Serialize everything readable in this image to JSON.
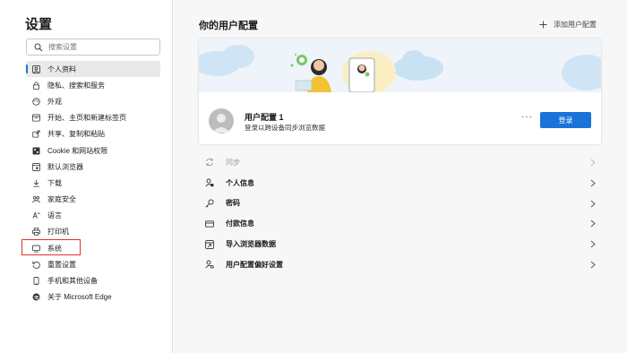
{
  "sidebar": {
    "title": "设置",
    "search_placeholder": "搜索设置",
    "items": [
      {
        "label": "个人资料",
        "icon": "profile-icon",
        "active": true
      },
      {
        "label": "隐私、搜索和服务",
        "icon": "lock-icon"
      },
      {
        "label": "外观",
        "icon": "appearance-icon"
      },
      {
        "label": "开始、主页和新建标签页",
        "icon": "home-icon"
      },
      {
        "label": "共享、复制和粘贴",
        "icon": "share-icon"
      },
      {
        "label": "Cookie 和网站权限",
        "icon": "cookie-icon"
      },
      {
        "label": "默认浏览器",
        "icon": "default-browser-icon"
      },
      {
        "label": "下载",
        "icon": "download-icon"
      },
      {
        "label": "家庭安全",
        "icon": "family-icon"
      },
      {
        "label": "语言",
        "icon": "language-icon"
      },
      {
        "label": "打印机",
        "icon": "printer-icon"
      },
      {
        "label": "系统",
        "icon": "system-icon",
        "highlighted": true
      },
      {
        "label": "重置设置",
        "icon": "reset-icon"
      },
      {
        "label": "手机和其他设备",
        "icon": "phone-icon"
      },
      {
        "label": "关于 Microsoft Edge",
        "icon": "edge-icon"
      }
    ]
  },
  "main": {
    "title": "你的用户配置",
    "add_profile_label": "添加用户配置",
    "profile": {
      "name": "用户配置 1",
      "subtitle": "登录以跨设备同步浏览数据",
      "more_label": "···",
      "login_label": "登录"
    },
    "rows": [
      {
        "label": "同步",
        "icon": "sync-icon",
        "disabled": true
      },
      {
        "label": "个人信息",
        "icon": "personal-info-icon"
      },
      {
        "label": "密码",
        "icon": "key-icon"
      },
      {
        "label": "付款信息",
        "icon": "card-icon"
      },
      {
        "label": "导入浏览器数据",
        "icon": "import-icon"
      },
      {
        "label": "用户配置偏好设置",
        "icon": "profile-prefs-icon"
      }
    ]
  },
  "colors": {
    "accent": "#1a73d9",
    "highlight_box": "#e0322f",
    "active_nav_bg": "#e9e9e9",
    "page_bg": "#f7f7f7",
    "banner_bg": "#eef4f9"
  }
}
